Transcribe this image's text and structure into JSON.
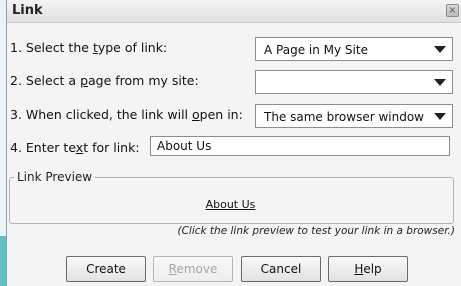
{
  "dialog": {
    "title": "Link",
    "close_glyph": "×"
  },
  "rows": {
    "link_type": {
      "label_prefix": "1. Select the ",
      "label_access": "t",
      "label_suffix": "ype of link:",
      "value": "A Page in My Site"
    },
    "page": {
      "label_prefix": "2. Select a ",
      "label_access": "p",
      "label_suffix": "age from my site:",
      "value": ""
    },
    "open_in": {
      "label_prefix": "3. When clicked, the link will ",
      "label_access": "o",
      "label_suffix": "pen in:",
      "value": "The same browser window"
    },
    "link_text": {
      "label_prefix": "4. Enter te",
      "label_access": "x",
      "label_suffix": "t for link:",
      "value": "About Us"
    }
  },
  "preview": {
    "legend": "Link Preview",
    "link_text": "About Us",
    "hint": "(Click the link preview to test your link in a browser.)"
  },
  "buttons": {
    "create": "Create",
    "remove_access": "R",
    "remove_rest": "emove",
    "cancel": "Cancel",
    "help_access": "H",
    "help_rest": "elp"
  },
  "icons": {
    "dropdown_arrow": "chevron-down-icon",
    "close": "close-icon"
  },
  "colors": {
    "teal_band": "#64bfc3",
    "dialog_bg": "#f4f4f4"
  }
}
